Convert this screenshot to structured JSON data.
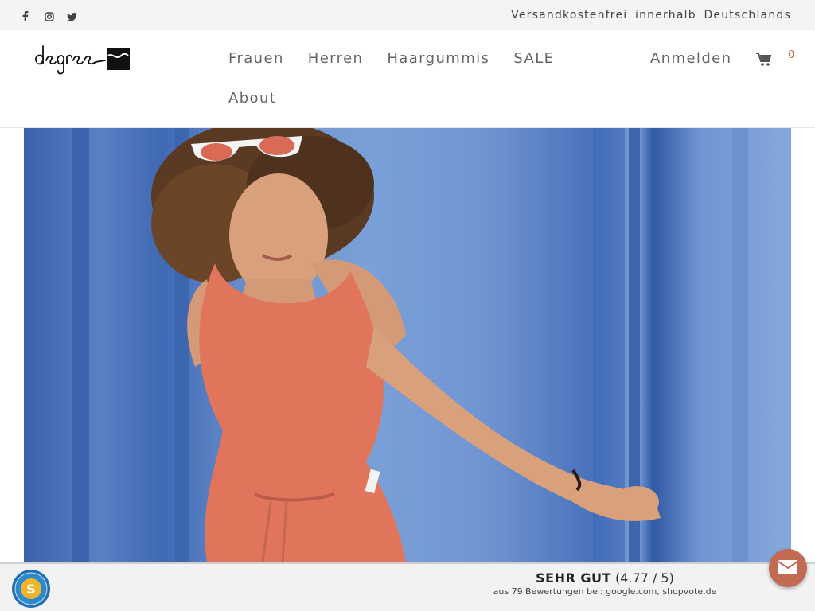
{
  "topbar": {
    "social": [
      {
        "icon": "facebook-icon"
      },
      {
        "icon": "instagram-icon"
      },
      {
        "icon": "twitter-icon"
      }
    ],
    "shipping_note": "Versandkostenfrei innerhalb Deutschlands"
  },
  "header": {
    "logo_text": "degree",
    "nav": {
      "frauen": "Frauen",
      "herren": "Herren",
      "haargummis": "Haargummis",
      "sale": "SALE",
      "about": "About"
    },
    "login": "Anmelden",
    "cart_count": "0"
  },
  "hero": {
    "icon": "hero-photo"
  },
  "rating": {
    "label": "SEHR GUT",
    "score": "(4.77 / 5)",
    "source": "aus 79 Bewertungen bei: google.com, shopvote.de"
  },
  "colors": {
    "accent": "#c26a52",
    "cart_count": "#c06b3f",
    "hero_blue": "#5a80c4",
    "topbar_bg": "#f4f4f4"
  }
}
